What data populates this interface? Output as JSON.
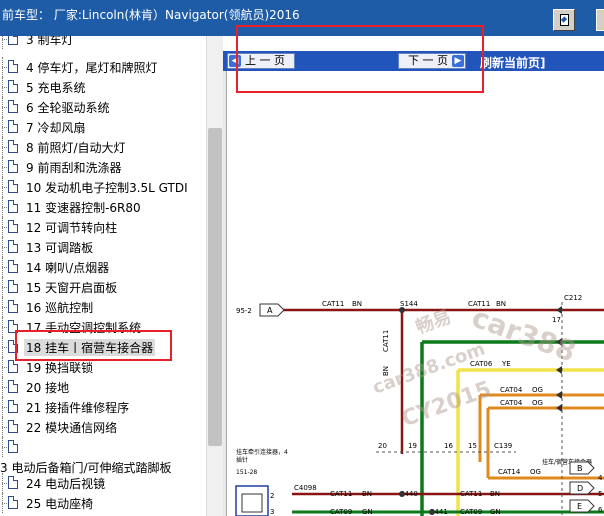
{
  "window": {
    "title": "前车型： 厂家:Lincoln(林肯）Navigator(领航员)2016"
  },
  "tree": {
    "items": [
      {
        "label": "3 制车灯",
        "kind": "doc"
      },
      {
        "label": "4 停车灯，尾灯和牌照灯",
        "kind": "doc"
      },
      {
        "label": "5 充电系统",
        "kind": "doc"
      },
      {
        "label": "6 全轮驱动系统",
        "kind": "doc"
      },
      {
        "label": "7 冷却风扇",
        "kind": "doc"
      },
      {
        "label": "8 前照灯/自动大灯",
        "kind": "doc"
      },
      {
        "label": "9 前雨刮和洗涤器",
        "kind": "doc"
      },
      {
        "label": "10 发动机电子控制3.5L GTDI",
        "kind": "doc"
      },
      {
        "label": "11 变速器控制-6R80",
        "kind": "doc"
      },
      {
        "label": "12 可调节转向柱",
        "kind": "doc"
      },
      {
        "label": "13 可调踏板",
        "kind": "doc"
      },
      {
        "label": "14 喇叭/点烟器",
        "kind": "doc"
      },
      {
        "label": "15 天窗开启面板",
        "kind": "doc"
      },
      {
        "label": "16 巡航控制",
        "kind": "doc"
      },
      {
        "label": "17 手动空调控制系统",
        "kind": "doc"
      },
      {
        "label": "18 挂车丨宿营车接合器",
        "kind": "doc",
        "selected": true
      },
      {
        "label": "19 换挡联锁",
        "kind": "doc"
      },
      {
        "label": "20 接地",
        "kind": "doc"
      },
      {
        "label": "21 接插件维修程序",
        "kind": "doc"
      },
      {
        "label": "22 模块通信网络",
        "kind": "doc"
      },
      {
        "label": "",
        "kind": "doc"
      },
      {
        "label": "3 电动后备箱门/可伸缩式踏脚板",
        "kind": "folder"
      },
      {
        "label": "24 电动后视镜",
        "kind": "doc"
      },
      {
        "label": "25 电动座椅",
        "kind": "doc"
      }
    ]
  },
  "viewer": {
    "prev_label": "上 一 页",
    "next_label": "下 一 页",
    "refresh_label": "刷新当前页]"
  },
  "diagram": {
    "labels": {
      "ref_left": "95-2",
      "conn_a": "A",
      "wire1": "CAT11",
      "wire1_color": "BN",
      "splice1": "S144",
      "wire2": "CAT11",
      "wire2_color": "BN",
      "conn_c212": "C212",
      "pin17": "17",
      "cat11_v": "CAT11",
      "bn_v": "BN",
      "cat06": "CAT06",
      "ye": "YE",
      "cat04": "CAT04",
      "og1": "OG",
      "cat04b": "CAT04",
      "og2": "OG",
      "pin20": "20",
      "pin19": "19",
      "pin16": "16",
      "pin15": "15",
      "c139": "C139",
      "trailer_module": "挂车牵引连接器，4",
      "trailer_module2": "插针",
      "ref_151": "151-28",
      "cat14": "CAT14",
      "og3": "OG",
      "trailer_right": "挂车/宿营车接合器",
      "c4098": "C4098",
      "cat11b": "CAT11",
      "bn3": "BN",
      "s440": "S440",
      "cat11c": "CAT11",
      "bn4": "BN",
      "cat09": "CAT09",
      "gn": "GN",
      "s441": "S441",
      "cat09b": "CAT09",
      "gn2": "GN",
      "pin2": "2",
      "pin3": "3",
      "pin4": "4",
      "pin5": "5",
      "pin6": "6",
      "conn_b": "B",
      "conn_d": "D",
      "conn_e": "E"
    },
    "watermark": [
      "畅易",
      "car388",
      "car388.com",
      "CY2015"
    ]
  },
  "colors": {
    "accent": "#1e5ca8",
    "highlight": "#e8202a"
  }
}
